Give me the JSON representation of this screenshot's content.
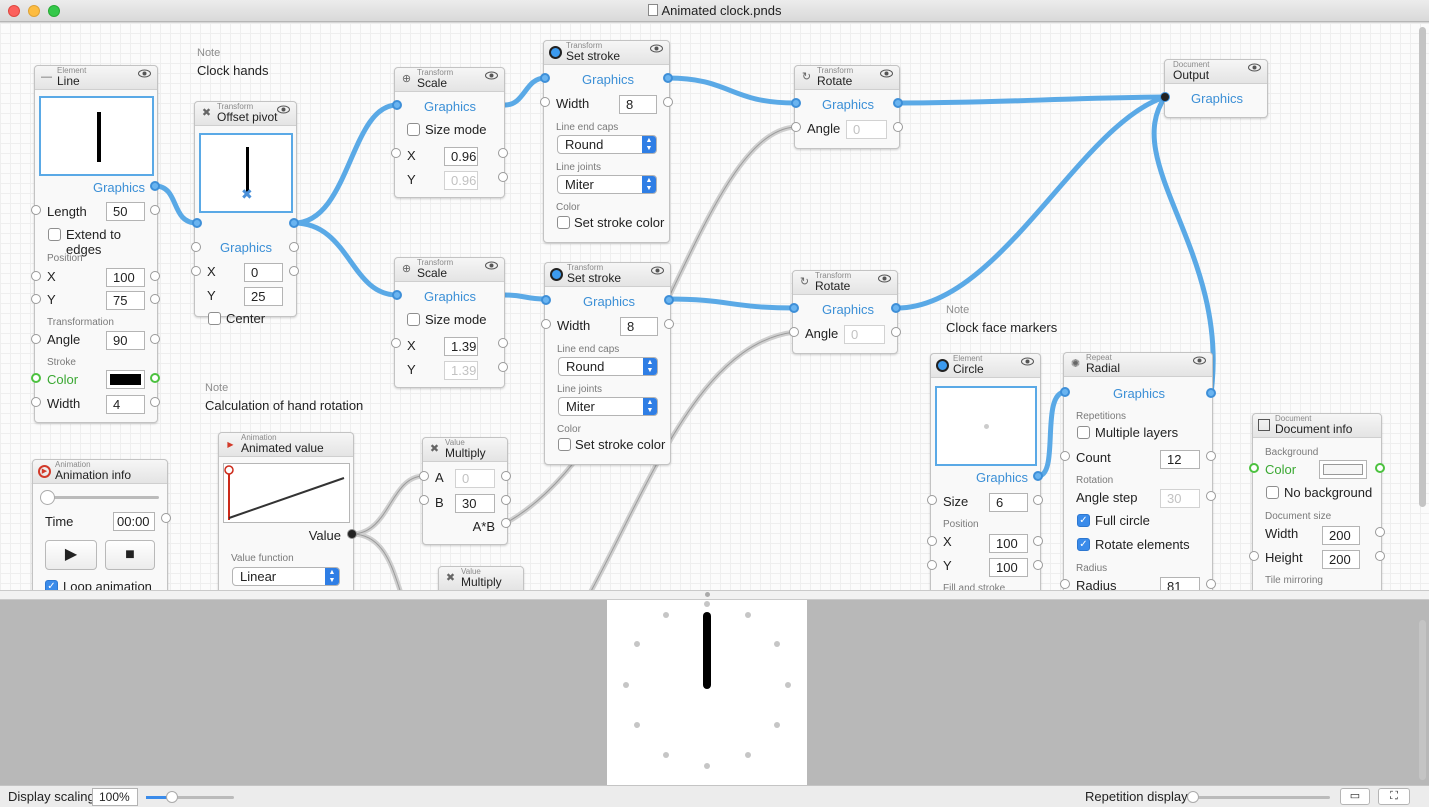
{
  "window": {
    "title": "Animated clock.pnds"
  },
  "notes": {
    "clock_hands": "Clock hands",
    "hand_rotation": "Calculation of hand rotation",
    "face_markers": "Clock face markers",
    "label": "Note"
  },
  "line": {
    "category": "Element",
    "name": "Line",
    "out": "Graphics",
    "length_label": "Length",
    "length": "50",
    "extend_label": "Extend to edges",
    "position": "Position",
    "x_label": "X",
    "x": "100",
    "y_label": "Y",
    "y": "75",
    "transformation": "Transformation",
    "angle_label": "Angle",
    "angle": "90",
    "stroke": "Stroke",
    "color_label": "Color",
    "width_label": "Width",
    "width": "4"
  },
  "offset": {
    "category": "Transform",
    "name": "Offset pivot",
    "in": "Graphics",
    "x_label": "X",
    "x": "0",
    "y_label": "Y",
    "y": "25",
    "center_label": "Center"
  },
  "scale1": {
    "category": "Transform",
    "name": "Scale",
    "in": "Graphics",
    "size_mode": "Size mode",
    "x_label": "X",
    "x": "0.96",
    "y_label": "Y",
    "y": "0.96"
  },
  "scale2": {
    "category": "Transform",
    "name": "Scale",
    "in": "Graphics",
    "size_mode": "Size mode",
    "x_label": "X",
    "x": "1.39",
    "y_label": "Y",
    "y": "1.39"
  },
  "stroke1": {
    "category": "Transform",
    "name": "Set stroke",
    "in": "Graphics",
    "width_label": "Width",
    "width": "8",
    "caps": "Line end caps",
    "caps_val": "Round",
    "joints": "Line joints",
    "joints_val": "Miter",
    "color": "Color",
    "set_color": "Set stroke color"
  },
  "stroke2": {
    "category": "Transform",
    "name": "Set stroke",
    "in": "Graphics",
    "width_label": "Width",
    "width": "8",
    "caps": "Line end caps",
    "caps_val": "Round",
    "joints": "Line joints",
    "joints_val": "Miter",
    "color": "Color",
    "set_color": "Set stroke color"
  },
  "rotate1": {
    "category": "Transform",
    "name": "Rotate",
    "in": "Graphics",
    "angle_label": "Angle",
    "angle": "0"
  },
  "rotate2": {
    "category": "Transform",
    "name": "Rotate",
    "in": "Graphics",
    "angle_label": "Angle",
    "angle": "0"
  },
  "output": {
    "category": "Document",
    "name": "Output",
    "in": "Graphics"
  },
  "anim_info": {
    "category": "Animation",
    "name": "Animation info",
    "time_label": "Time",
    "time": "00:00",
    "loop": "Loop animation",
    "play": "▶",
    "stop": "■"
  },
  "anim_value": {
    "category": "Animation",
    "name": "Animated value",
    "out": "Value",
    "func_label": "Value function",
    "func": "Linear"
  },
  "multiply1": {
    "category": "Value",
    "name": "Multiply",
    "a_label": "A",
    "a": "0",
    "b_label": "B",
    "b": "30",
    "out": "A*B"
  },
  "multiply2": {
    "category": "Value",
    "name": "Multiply"
  },
  "circle": {
    "category": "Element",
    "name": "Circle",
    "out": "Graphics",
    "size_label": "Size",
    "size": "6",
    "position": "Position",
    "x_label": "X",
    "x": "100",
    "y_label": "Y",
    "y": "100",
    "fill": "Fill and stroke"
  },
  "radial": {
    "category": "Repeat",
    "name": "Radial",
    "in": "Graphics",
    "repetitions": "Repetitions",
    "multiple": "Multiple layers",
    "count_label": "Count",
    "count": "12",
    "rotation": "Rotation",
    "step_label": "Angle step",
    "step": "30",
    "full": "Full circle",
    "rotate_el": "Rotate elements",
    "radius": "Radius",
    "radius_label": "Radius",
    "radius_val": "81"
  },
  "docinfo": {
    "category": "Document",
    "name": "Document info",
    "background": "Background",
    "color_label": "Color",
    "no_bg": "No background",
    "docsize": "Document size",
    "width_label": "Width",
    "width": "200",
    "height_label": "Height",
    "height": "200",
    "mirroring": "Tile mirroring"
  },
  "status": {
    "scaling_label": "Display scaling",
    "scaling": "100%",
    "repetition_label": "Repetition display"
  },
  "colors": {
    "wire": "#5aa9e6",
    "accent": "#3a8bea"
  }
}
